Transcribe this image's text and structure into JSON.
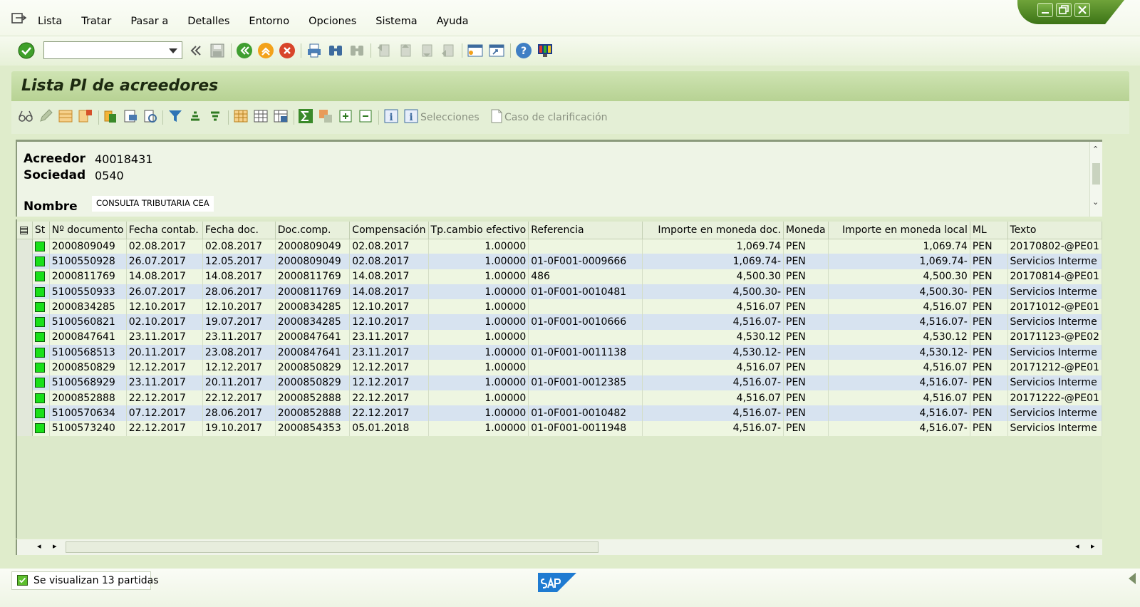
{
  "menu": {
    "items": [
      "Lista",
      "Tratar",
      "Pasar a",
      "Detalles",
      "Entorno",
      "Opciones",
      "Sistema",
      "Ayuda"
    ]
  },
  "toolbar": {
    "command_value": "",
    "icons": [
      "enter-icon",
      "back-icon",
      "save-icon",
      "back-green-icon",
      "exit-icon",
      "cancel-icon",
      "print-icon",
      "find-icon",
      "find-next-icon",
      "first-page-icon",
      "prev-page-icon",
      "next-page-icon",
      "last-page-icon",
      "new-session-icon",
      "shortcut-icon",
      "help-icon",
      "layout-icon"
    ]
  },
  "title": "Lista PI de acreedores",
  "alv": {
    "selecciones": "Selecciones",
    "caso": "Caso de clarificación"
  },
  "header": {
    "acreedor_label": "Acreedor",
    "acreedor_value": "40018431",
    "sociedad_label": "Sociedad",
    "sociedad_value": "0540",
    "nombre_label": "Nombre",
    "nombre_value": "CONSULTA TRIBUTARIA CEA"
  },
  "grid": {
    "columns": [
      "St",
      "Nº documento",
      "Fecha contab.",
      "Fecha doc.",
      "Doc.comp.",
      "Compensación",
      "Tp.cambio efectivo",
      "Referencia",
      "Importe en moneda doc.",
      "Moneda",
      "Importe en moneda local",
      "ML",
      "Texto"
    ],
    "rows": [
      [
        "2000809049",
        "02.08.2017",
        "02.08.2017",
        "2000809049",
        "02.08.2017",
        "1.00000",
        "",
        "1,069.74",
        "PEN",
        "1,069.74",
        "PEN",
        "20170802-@PE01"
      ],
      [
        "5100550928",
        "26.07.2017",
        "12.05.2017",
        "2000809049",
        "02.08.2017",
        "1.00000",
        "01-0F001-0009666",
        "1,069.74-",
        "PEN",
        "1,069.74-",
        "PEN",
        "Servicios Interme"
      ],
      [
        "2000811769",
        "14.08.2017",
        "14.08.2017",
        "2000811769",
        "14.08.2017",
        "1.00000",
        "486",
        "4,500.30",
        "PEN",
        "4,500.30",
        "PEN",
        "20170814-@PE01"
      ],
      [
        "5100550933",
        "26.07.2017",
        "28.06.2017",
        "2000811769",
        "14.08.2017",
        "1.00000",
        "01-0F001-0010481",
        "4,500.30-",
        "PEN",
        "4,500.30-",
        "PEN",
        "Servicios Interme"
      ],
      [
        "2000834285",
        "12.10.2017",
        "12.10.2017",
        "2000834285",
        "12.10.2017",
        "1.00000",
        "",
        "4,516.07",
        "PEN",
        "4,516.07",
        "PEN",
        "20171012-@PE01"
      ],
      [
        "5100560821",
        "02.10.2017",
        "19.07.2017",
        "2000834285",
        "12.10.2017",
        "1.00000",
        "01-0F001-0010666",
        "4,516.07-",
        "PEN",
        "4,516.07-",
        "PEN",
        "Servicios Interme"
      ],
      [
        "2000847641",
        "23.11.2017",
        "23.11.2017",
        "2000847641",
        "23.11.2017",
        "1.00000",
        "",
        "4,530.12",
        "PEN",
        "4,530.12",
        "PEN",
        "20171123-@PE02"
      ],
      [
        "5100568513",
        "20.11.2017",
        "23.08.2017",
        "2000847641",
        "23.11.2017",
        "1.00000",
        "01-0F001-0011138",
        "4,530.12-",
        "PEN",
        "4,530.12-",
        "PEN",
        "Servicios Interme"
      ],
      [
        "2000850829",
        "12.12.2017",
        "12.12.2017",
        "2000850829",
        "12.12.2017",
        "1.00000",
        "",
        "4,516.07",
        "PEN",
        "4,516.07",
        "PEN",
        "20171212-@PE01"
      ],
      [
        "5100568929",
        "23.11.2017",
        "20.11.2017",
        "2000850829",
        "12.12.2017",
        "1.00000",
        "01-0F001-0012385",
        "4,516.07-",
        "PEN",
        "4,516.07-",
        "PEN",
        "Servicios Interme"
      ],
      [
        "2000852888",
        "22.12.2017",
        "22.12.2017",
        "2000852888",
        "22.12.2017",
        "1.00000",
        "",
        "4,516.07",
        "PEN",
        "4,516.07",
        "PEN",
        "20171222-@PE01"
      ],
      [
        "5100570634",
        "07.12.2017",
        "28.06.2017",
        "2000852888",
        "22.12.2017",
        "1.00000",
        "01-0F001-0010482",
        "4,516.07-",
        "PEN",
        "4,516.07-",
        "PEN",
        "Servicios Interme"
      ],
      [
        "5100573240",
        "22.12.2017",
        "19.10.2017",
        "2000854353",
        "05.01.2018",
        "1.00000",
        "01-0F001-0011948",
        "4,516.07-",
        "PEN",
        "4,516.07-",
        "PEN",
        "Servicios Interme"
      ]
    ]
  },
  "status": {
    "message": "Se visualizan 13 partidas"
  },
  "colors": {
    "status_green": "#19e019",
    "title_green": "#b7d293",
    "row_alt_blue": "#d7e3f0"
  }
}
